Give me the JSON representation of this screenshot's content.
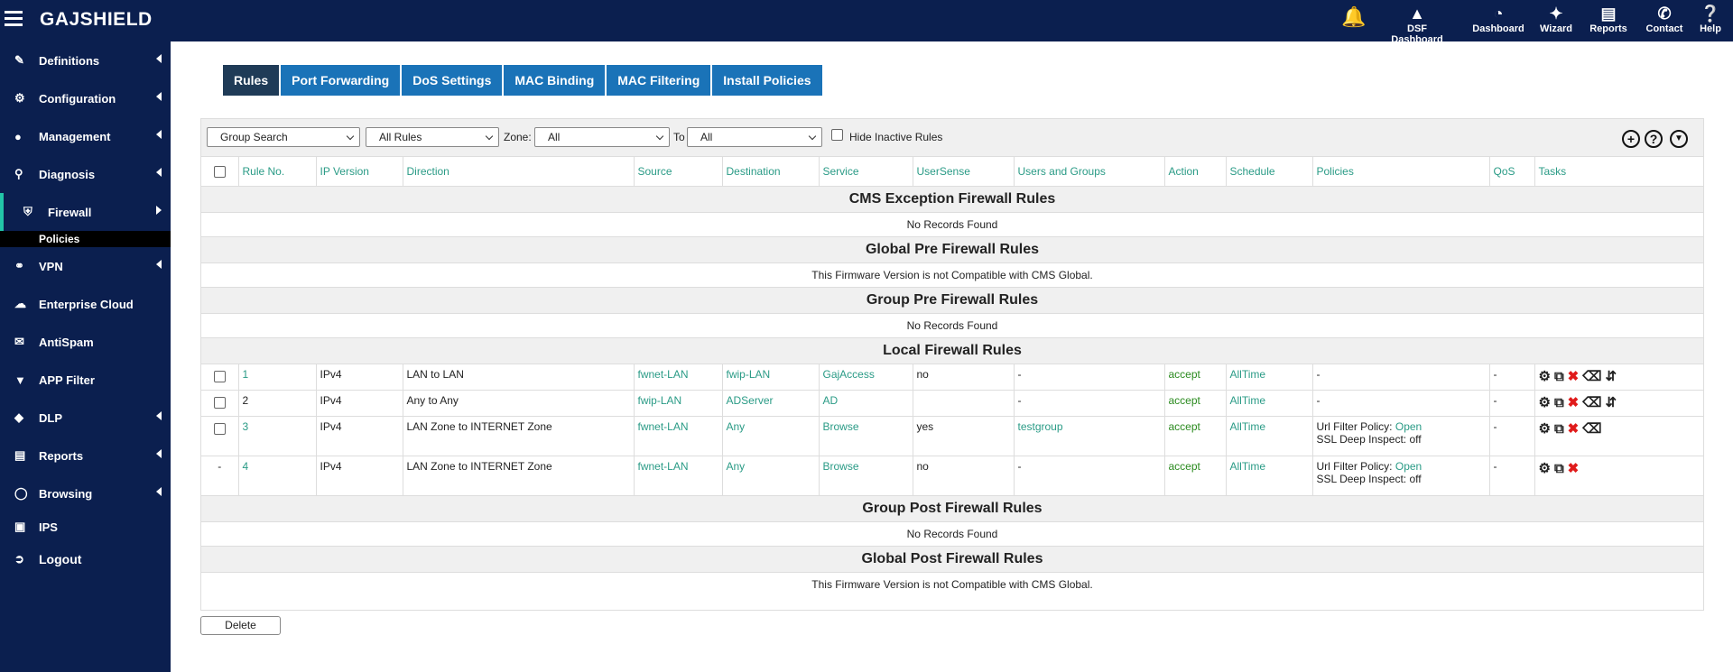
{
  "app": {
    "logo": "GAJSHIELD"
  },
  "top_nav": [
    {
      "label": "DSF Dashboard",
      "icon": "chart-icon"
    },
    {
      "label": "Dashboard",
      "icon": "gauge-icon"
    },
    {
      "label": "Wizard",
      "icon": "wand-icon"
    },
    {
      "label": "Reports",
      "icon": "document-icon"
    },
    {
      "label": "Contact",
      "icon": "phone-icon"
    },
    {
      "label": "Help",
      "icon": "help-icon"
    }
  ],
  "sidebar": {
    "items": [
      {
        "label": "Definitions",
        "icon": "edit-icon",
        "arrow": true
      },
      {
        "label": "Configuration",
        "icon": "gear-icon",
        "arrow": true
      },
      {
        "label": "Management",
        "icon": "user-icon",
        "arrow": true
      },
      {
        "label": "Diagnosis",
        "icon": "search-icon",
        "arrow": true
      },
      {
        "label": "Firewall",
        "icon": "shield-icon",
        "arrow": true,
        "active": true
      },
      {
        "label": "VPN",
        "icon": "network-icon",
        "arrow": true
      },
      {
        "label": "Enterprise Cloud",
        "icon": "cloud-icon",
        "arrow": false
      },
      {
        "label": "AntiSpam",
        "icon": "mail-icon",
        "arrow": false
      },
      {
        "label": "APP Filter",
        "icon": "filter-icon",
        "arrow": false
      },
      {
        "label": "DLP",
        "icon": "dlp-icon",
        "arrow": true
      },
      {
        "label": "Reports",
        "icon": "report-icon",
        "arrow": true
      },
      {
        "label": "Browsing",
        "icon": "globe-icon",
        "arrow": true
      },
      {
        "label": "IPS",
        "icon": "lock-icon",
        "arrow": false
      },
      {
        "label": "Logout",
        "icon": "logout-icon",
        "arrow": false
      }
    ],
    "sub_item": "Policies"
  },
  "tabs": [
    "Rules",
    "Port Forwarding",
    "DoS Settings",
    "MAC Binding",
    "MAC Filtering",
    "Install Policies"
  ],
  "toolbar": {
    "group_search": "Group Search",
    "rules_filter": "All Rules",
    "zone_label": "Zone:",
    "zone_value": "All",
    "to_label": "To",
    "to_value": "All",
    "hide_inactive_label": "Hide Inactive Rules"
  },
  "table": {
    "headers": [
      "Rule No.",
      "IP Version",
      "Direction",
      "Source",
      "Destination",
      "Service",
      "UserSense",
      "Users and Groups",
      "Action",
      "Schedule",
      "Policies",
      "QoS",
      "Tasks"
    ],
    "sections": {
      "cms_exception": "CMS Exception Firewall Rules",
      "global_pre": "Global Pre Firewall Rules",
      "group_pre": "Group Pre Firewall Rules",
      "local": "Local Firewall Rules",
      "group_post": "Group Post Firewall Rules",
      "global_post": "Global Post Firewall Rules"
    },
    "messages": {
      "no_records": "No Records Found",
      "not_compatible": "This Firmware Version is not Compatible with CMS Global."
    },
    "rows": [
      {
        "no": "1",
        "ip": "IPv4",
        "direction": "LAN to LAN",
        "source": "fwnet-LAN",
        "destination": "fwip-LAN",
        "service": "GajAccess",
        "usersense": "no",
        "users": "-",
        "action": "accept",
        "schedule": "AllTime",
        "policy1": "-",
        "qos": "-"
      },
      {
        "no": "2",
        "ip": "IPv4",
        "direction": "Any to Any",
        "source": "fwip-LAN",
        "destination": "ADServer",
        "service": "AD",
        "usersense": "",
        "users": "-",
        "action": "accept",
        "schedule": "AllTime",
        "policy1": "-",
        "qos": "-"
      },
      {
        "no": "3",
        "ip": "IPv4",
        "direction": "LAN Zone to INTERNET Zone",
        "source": "fwnet-LAN",
        "destination": "Any",
        "service": "Browse",
        "usersense": "yes",
        "users": "testgroup",
        "action": "accept",
        "schedule": "AllTime",
        "policy1": "Url Filter Policy:",
        "policy_link": "Open",
        "policy2": "SSL Deep Inspect: off",
        "qos": "-"
      },
      {
        "no": "4",
        "ip": "IPv4",
        "direction": "LAN Zone to INTERNET Zone",
        "source": "fwnet-LAN",
        "destination": "Any",
        "service": "Browse",
        "usersense": "no",
        "users": "-",
        "action": "accept",
        "schedule": "AllTime",
        "policy1": "Url Filter Policy:",
        "policy_link": "Open",
        "policy2": "SSL Deep Inspect: off",
        "qos": "-",
        "checkbox_placeholder": "-"
      }
    ]
  },
  "delete_button": "Delete"
}
